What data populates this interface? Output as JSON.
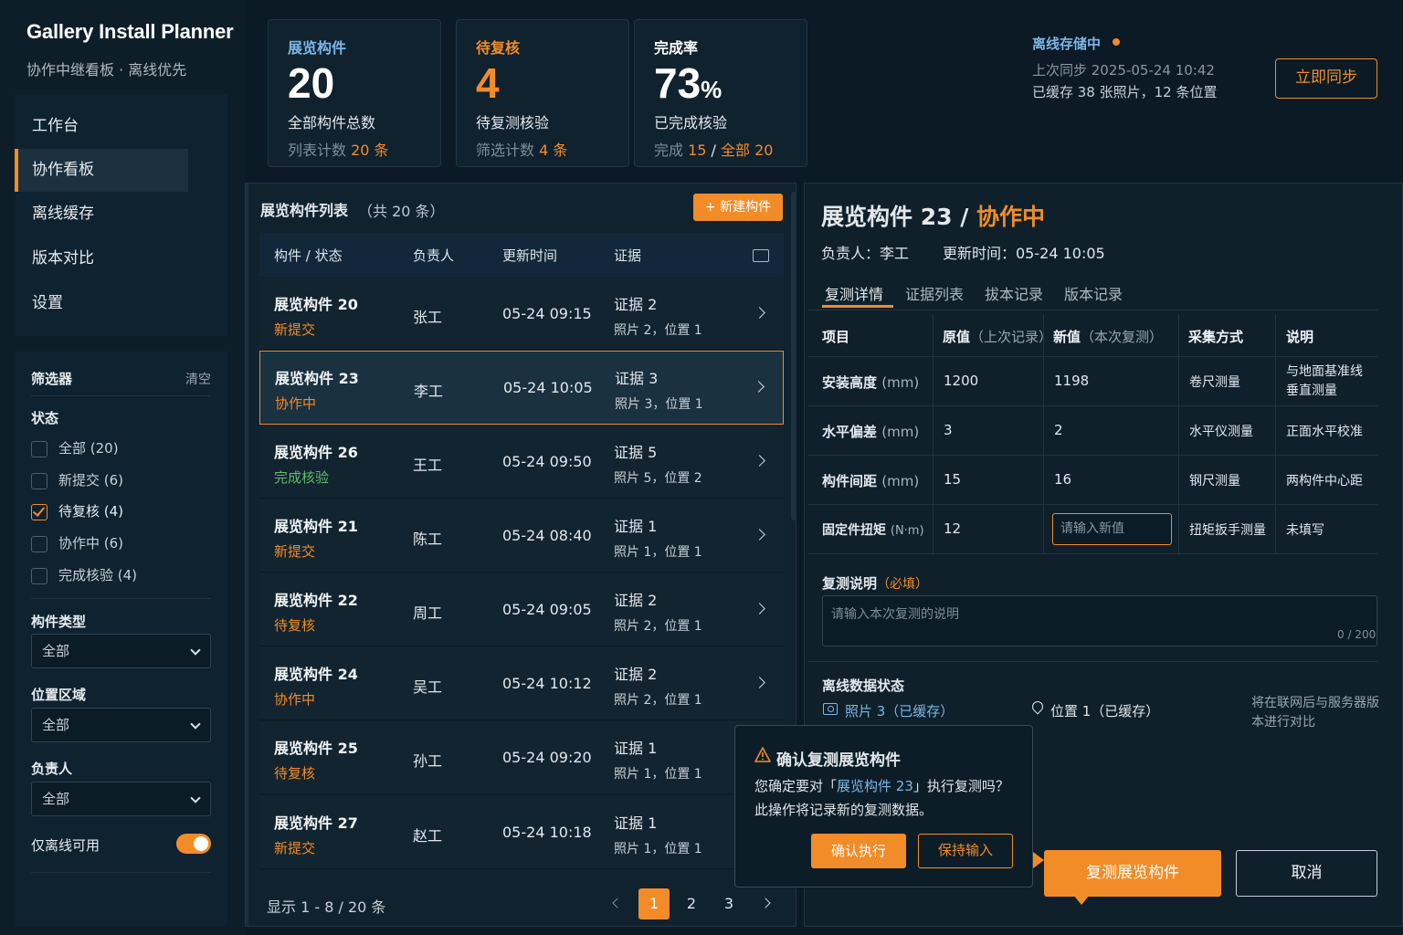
{
  "app": {
    "title": "Gallery Install Planner",
    "subtitle": "协作中继看板 · 离线优先"
  },
  "nav": [
    {
      "label": "工作台",
      "active": false
    },
    {
      "label": "协作看板",
      "active": true
    },
    {
      "label": "离线缓存",
      "active": false
    },
    {
      "label": "版本对比",
      "active": false
    },
    {
      "label": "设置",
      "active": false
    }
  ],
  "filters": {
    "title": "筛选器",
    "clear": "清空",
    "status_label": "状态",
    "status_options": [
      {
        "label": "全部 (20)",
        "checked": false
      },
      {
        "label": "新提交 (6)",
        "checked": false
      },
      {
        "label": "待复核 (4)",
        "checked": true
      },
      {
        "label": "协作中 (6)",
        "checked": false
      },
      {
        "label": "完成核验 (4)",
        "checked": false
      }
    ],
    "type_label": "构件类型",
    "type_value": "全部",
    "area_label": "位置区域",
    "area_value": "全部",
    "owner_label": "负责人",
    "owner_value": "全部",
    "offline_label": "仅离线可用",
    "offline_on": true
  },
  "stats": [
    {
      "title": "展览构件",
      "num": "20",
      "unit": "",
      "desc": "全部构件总数",
      "foot_a": "列表计数 ",
      "foot_b": "20 条",
      "foot_c": "",
      "foot_d": ""
    },
    {
      "title": "待复核",
      "num": "4",
      "unit": "",
      "desc": "待复测核验",
      "foot_a": "筛选计数 ",
      "foot_b": "4 条",
      "foot_c": "",
      "foot_d": ""
    },
    {
      "title": "完成率",
      "num": "73",
      "unit": "%",
      "desc": "已完成核验",
      "foot_a": "完成 ",
      "foot_b": "15",
      "foot_c": " / ",
      "foot_d": "全部 20"
    }
  ],
  "sync": {
    "title": "离线存储中",
    "last": "上次同步 2025-05-24 10:42",
    "cache": "已缓存 38 张照片，12 条位置",
    "button": "立即同步"
  },
  "list": {
    "title": "展览构件列表",
    "count": "（共 20 条）",
    "new_button": "+ 新建构件",
    "headers": {
      "name": "构件 / 状态",
      "owner": "负责人",
      "time": "更新时间",
      "evidence": "证据"
    },
    "rows": [
      {
        "name": "展览构件 20",
        "status": "新提交",
        "tone": "orange",
        "owner": "张工",
        "time": "05-24 09:15",
        "ev": "证据 2",
        "ev2": "照片 2，位置 1"
      },
      {
        "name": "展览构件 23",
        "status": "协作中",
        "tone": "orange",
        "owner": "李工",
        "time": "05-24 10:05",
        "ev": "证据 3",
        "ev2": "照片 3，位置 1",
        "selected": true
      },
      {
        "name": "展览构件 26",
        "status": "完成核验",
        "tone": "green",
        "owner": "王工",
        "time": "05-24 09:50",
        "ev": "证据 5",
        "ev2": "照片 5，位置 2"
      },
      {
        "name": "展览构件 21",
        "status": "新提交",
        "tone": "orange",
        "owner": "陈工",
        "time": "05-24 08:40",
        "ev": "证据 1",
        "ev2": "照片 1，位置 1"
      },
      {
        "name": "展览构件 22",
        "status": "待复核",
        "tone": "orange",
        "owner": "周工",
        "time": "05-24 09:05",
        "ev": "证据 2",
        "ev2": "照片 2，位置 1"
      },
      {
        "name": "展览构件 24",
        "status": "协作中",
        "tone": "orange",
        "owner": "吴工",
        "time": "05-24 10:12",
        "ev": "证据 2",
        "ev2": "照片 2，位置 1"
      },
      {
        "name": "展览构件 25",
        "status": "待复核",
        "tone": "orange",
        "owner": "孙工",
        "time": "05-24 09:20",
        "ev": "证据 1",
        "ev2": "照片 1，位置 1"
      },
      {
        "name": "展览构件 27",
        "status": "新提交",
        "tone": "orange",
        "owner": "赵工",
        "time": "05-24 10:18",
        "ev": "证据 1",
        "ev2": "照片 1，位置 1"
      }
    ],
    "pager_info": "显示 1 - 8 / 20 条",
    "pages": [
      "1",
      "2",
      "3"
    ],
    "current_page": "1"
  },
  "detail": {
    "title": "展览构件 23 / ",
    "title_status": "协作中",
    "owner": "负责人：李工",
    "time": "更新时间：05-24 10:05",
    "tabs": [
      "复测详情",
      "证据列表",
      "拔本记录",
      "版本记录"
    ],
    "table_headers": {
      "item": "项目",
      "old": "原值",
      "old_sub": "（上次记录）",
      "new": "新值",
      "new_sub": "（本次复测）",
      "method": "采集方式",
      "note": "说明"
    },
    "table_rows": [
      {
        "item": "安装高度",
        "unit": "(mm)",
        "old": "1200",
        "new": "1198",
        "method": "卷尺测量",
        "note": "与地面基准线垂直测量"
      },
      {
        "item": "水平偏差",
        "unit": "(mm)",
        "old": "3",
        "new": "2",
        "method": "水平仪测量",
        "note": "正面水平校准"
      },
      {
        "item": "构件间距",
        "unit": "(mm)",
        "old": "15",
        "new": "16",
        "method": "钢尺测量",
        "note": "两构件中心距"
      },
      {
        "item": "固定件扭矩",
        "unit": "(N·m)",
        "old": "12",
        "new_placeholder": "请输入新值",
        "method": "扭矩扳手测量",
        "note": "未填写"
      }
    ],
    "note_label": "复测说明",
    "note_required": "（必填）",
    "note_placeholder": "请输入本次复测的说明",
    "note_count": "0 / 200",
    "offline_label": "离线数据状态",
    "offline_photo": "照片 3（已缓存）",
    "offline_loc": "位置 1（已缓存）",
    "offline_note": "将在联网后与服务器版本进行对比",
    "primary_button": "复测展览构件",
    "cancel_button": "取消"
  },
  "popover": {
    "title": "确认复测展览构件",
    "line1_a": "您确定要对「",
    "line1_b": "展览构件 23",
    "line1_c": "」执行复测吗？",
    "line2": "此操作将记录新的复测数据。",
    "confirm": "确认执行",
    "keep": "保持输入"
  },
  "colors": {
    "accent": "#f28c28",
    "success": "#5ebd6e",
    "link": "#7cb7e8",
    "bg": "#0b1a24"
  }
}
